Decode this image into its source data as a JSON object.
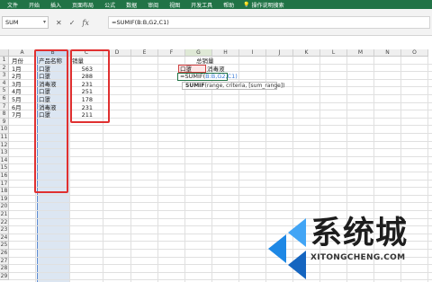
{
  "ribbon": {
    "tabs": [
      "文件",
      "开始",
      "插入",
      "页面布局",
      "公式",
      "数据",
      "审阅",
      "视图",
      "开发工具",
      "帮助"
    ],
    "tell_me": "操作说明搜索"
  },
  "formula_bar": {
    "name_box": "SUM",
    "cancel": "✕",
    "enter": "✓",
    "fx": "fx",
    "formula": "=SUMIF(B:B,G2,C1)"
  },
  "columns": [
    "A",
    "B",
    "C",
    "D",
    "E",
    "F",
    "G",
    "H",
    "I",
    "J",
    "K",
    "L",
    "M",
    "N",
    "O"
  ],
  "rows": [
    "1",
    "2",
    "3",
    "4",
    "5",
    "6",
    "7",
    "8",
    "9",
    "10",
    "11",
    "12",
    "13",
    "14",
    "15",
    "16",
    "17",
    "18",
    "19",
    "20",
    "21",
    "22",
    "23",
    "24",
    "25",
    "26",
    "27",
    "28",
    "29"
  ],
  "sheet": {
    "headers": {
      "a1": "月份",
      "b1": "产品名称",
      "c1": "销量"
    },
    "data": [
      {
        "month": "1月",
        "product": "口罩",
        "qty": "563"
      },
      {
        "month": "2月",
        "product": "口罩",
        "qty": "288"
      },
      {
        "month": "3月",
        "product": "消毒液",
        "qty": "231"
      },
      {
        "month": "4月",
        "product": "口罩",
        "qty": "251"
      },
      {
        "month": "5月",
        "product": "口罩",
        "qty": "178"
      },
      {
        "month": "6月",
        "product": "消毒液",
        "qty": "231"
      },
      {
        "month": "7月",
        "product": "口罩",
        "qty": "211"
      }
    ],
    "g1": "总销量",
    "g2": "口罩",
    "h2": "消毒液",
    "edit_prefix": "=SUMIF(",
    "edit_args": "B:B,G2,C1)",
    "tooltip_fn": "SUMIF",
    "tooltip_args": "(range, criteria, [sum_range])"
  },
  "watermark": {
    "brand": "系统城",
    "url": "XITONGCHENG.COM"
  },
  "colors": {
    "ribbon": "#217346",
    "selection": "#dce6f2",
    "highlight": "#e03030",
    "logo_blue": "#1e88e5"
  }
}
